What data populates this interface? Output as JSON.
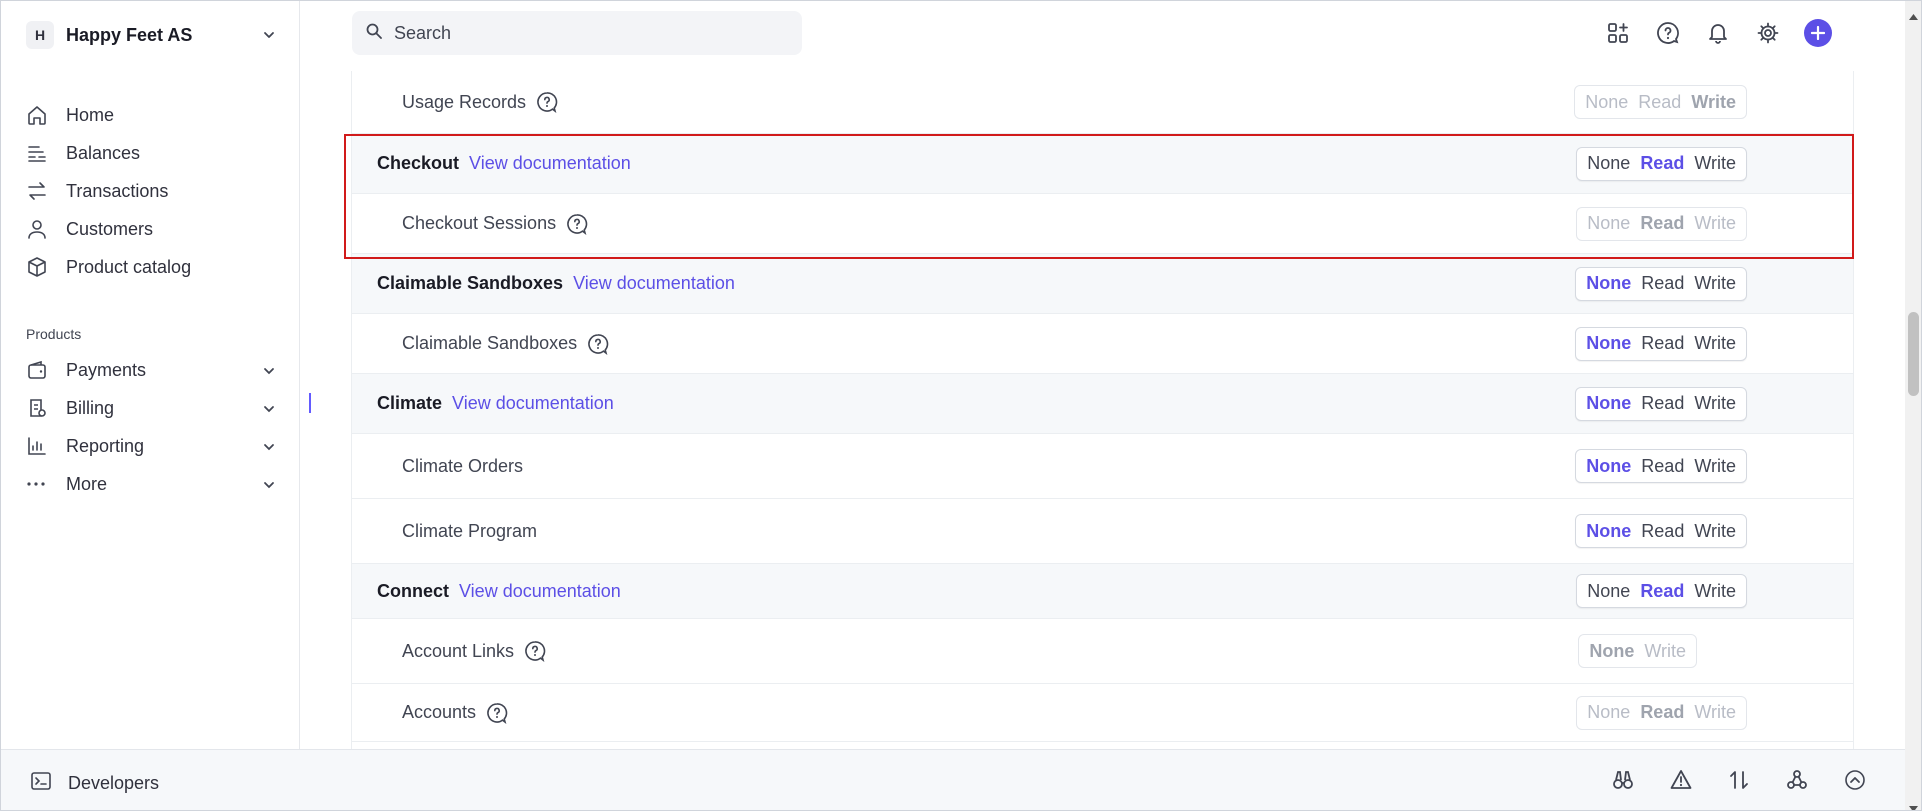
{
  "account": {
    "badge": "H",
    "name": "Happy Feet AS"
  },
  "nav": [
    {
      "label": "Home",
      "icon": "home-icon"
    },
    {
      "label": "Balances",
      "icon": "balances-icon"
    },
    {
      "label": "Transactions",
      "icon": "transactions-icon"
    },
    {
      "label": "Customers",
      "icon": "customers-icon"
    },
    {
      "label": "Product catalog",
      "icon": "product-catalog-icon"
    }
  ],
  "products_label": "Products",
  "products": [
    {
      "label": "Payments",
      "icon": "wallet-icon"
    },
    {
      "label": "Billing",
      "icon": "billing-icon"
    },
    {
      "label": "Reporting",
      "icon": "reporting-icon"
    },
    {
      "label": "More",
      "icon": "more-icon"
    }
  ],
  "search": {
    "placeholder": "Search"
  },
  "permissions": {
    "view_doc": "View documentation",
    "none": "None",
    "read": "Read",
    "write": "Write",
    "rows": [
      {
        "kind": "sub",
        "name": "Usage Records",
        "help": true,
        "state": "disabled",
        "selected": "Write"
      },
      {
        "kind": "group",
        "name": "Checkout",
        "doc": true,
        "selected": "Read"
      },
      {
        "kind": "sub",
        "name": "Checkout Sessions",
        "help": true,
        "state": "disabled",
        "selected": "Read"
      },
      {
        "kind": "group",
        "name": "Claimable Sandboxes",
        "doc": true,
        "selected": "None"
      },
      {
        "kind": "sub",
        "name": "Claimable Sandboxes",
        "help": true,
        "selected": "None"
      },
      {
        "kind": "group",
        "name": "Climate",
        "doc": true,
        "selected": "None"
      },
      {
        "kind": "sub",
        "name": "Climate Orders",
        "selected": "None"
      },
      {
        "kind": "sub",
        "name": "Climate Program",
        "selected": "None"
      },
      {
        "kind": "group",
        "name": "Connect",
        "doc": true,
        "selected": "Read"
      },
      {
        "kind": "sub",
        "name": "Account Links",
        "help": true,
        "state": "disabled",
        "options": [
          "None",
          "Write"
        ],
        "selected": "None"
      },
      {
        "kind": "sub",
        "name": "Accounts",
        "help": true,
        "state": "disabled",
        "selected": "Read"
      }
    ]
  },
  "bottom": {
    "developers": "Developers"
  },
  "colors": {
    "accent": "#5c4fe6",
    "highlight": "#d11a1a"
  }
}
